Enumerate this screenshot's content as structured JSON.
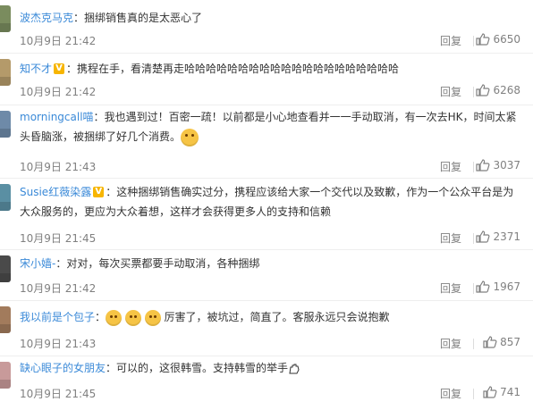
{
  "comments": [
    {
      "username": "波杰克马克",
      "verified": false,
      "separator": "：",
      "text": "捆绑销售真的是太恶心了",
      "time": "10月9日 21:42",
      "reply_label": "回复",
      "likes": "6650",
      "avatar_color": "#7a8c5e"
    },
    {
      "username": "知不才",
      "verified": true,
      "separator": "：",
      "text": "携程在手，看清楚再走哈哈哈哈哈哈哈哈哈哈哈哈哈哈哈哈哈哈哈哈",
      "time": "10月9日 21:42",
      "reply_label": "回复",
      "likes": "6268",
      "avatar_color": "#b49a6a"
    },
    {
      "username": "morningcall喵",
      "verified": false,
      "separator": "：",
      "text": "我也遇到过！百密一疏！以前都是小心地查看并一一手动取消，有一次去HK，时间太紧头昏脑涨，被捆绑了好几个消费。",
      "time": "10月9日 21:43",
      "reply_label": "回复",
      "likes": "3037",
      "avatar_color": "#6e8aa8"
    },
    {
      "username": "Susie红薇染露",
      "verified": true,
      "separator": "：",
      "text": "这种捆绑销售确实过分，携程应该给大家一个交代以及致歉，作为一个公众平台是为大众服务的，更应为大众着想，这样才会获得更多人的支持和信赖",
      "time": "10月9日 21:45",
      "reply_label": "回复",
      "likes": "2371",
      "avatar_color": "#5a8fa3"
    },
    {
      "username": "宋小嫱-",
      "verified": false,
      "separator": "：",
      "text": "对对，每次买票都要手动取消，各种捆绑",
      "time": "10月9日 21:42",
      "reply_label": "回复",
      "likes": "1967",
      "avatar_color": "#4a4a4a"
    },
    {
      "username": "我以前是个包子",
      "verified": false,
      "separator": "：",
      "text": "厉害了，被坑过，简直了。客服永远只会说抱歉",
      "time": "10月9日 21:43",
      "reply_label": "回复",
      "likes": "857",
      "avatar_color": "#a27b5c"
    },
    {
      "username": "缺心眼子的女朋友",
      "verified": false,
      "separator": "：",
      "text": "可以的，这很韩雪。支持韩雪的举手",
      "time": "10月9日 21:45",
      "reply_label": "回复",
      "likes": "741",
      "avatar_color": "#c89a9a"
    }
  ],
  "colors": {
    "username": "#eb7350",
    "meta_text": "#808080",
    "divider": "#eeeeee"
  }
}
